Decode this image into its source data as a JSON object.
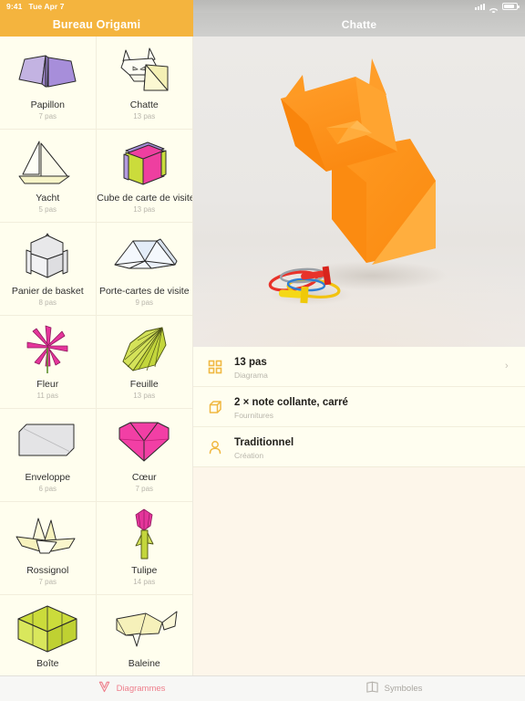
{
  "status_bar": {
    "time": "9:41",
    "date": "Tue Apr 7",
    "icons": [
      "signal-icon",
      "wifi-icon",
      "battery-icon"
    ]
  },
  "sidebar": {
    "header_title": "Bureau Origami",
    "background_color": "#FFFEEE",
    "accent_color": "#F4B43E",
    "steps_unit": "pas",
    "items": [
      {
        "name": "Papillon",
        "steps": "7 pas",
        "icon": "origami-butterfly-icon",
        "color": "#B9A5DC"
      },
      {
        "name": "Chatte",
        "steps": "13 pas",
        "icon": "origami-cat-icon",
        "color": "#F4F0B4"
      },
      {
        "name": "Yacht",
        "steps": "5 pas",
        "icon": "origami-yacht-icon",
        "color": "#F7F4C8"
      },
      {
        "name": "Cube de carte de visite",
        "steps": "13 pas",
        "icon": "origami-card-cube-icon",
        "color": "#EE3FA0"
      },
      {
        "name": "Panier de basket",
        "steps": "8 pas",
        "icon": "origami-basket-icon",
        "color": "#E8E8EA"
      },
      {
        "name": "Porte-cartes de visite",
        "steps": "9 pas",
        "icon": "origami-card-holder-icon",
        "color": "#EFF4FB"
      },
      {
        "name": "Fleur",
        "steps": "11 pas",
        "icon": "origami-flower-icon",
        "color": "#E5359B"
      },
      {
        "name": "Feuille",
        "steps": "13 pas",
        "icon": "origami-leaf-icon",
        "color": "#C3D63C"
      },
      {
        "name": "Enveloppe",
        "steps": "6 pas",
        "icon": "origami-envelope-icon",
        "color": "#E4E4E6"
      },
      {
        "name": "Cœur",
        "steps": "7 pas",
        "icon": "origami-heart-icon",
        "color": "#F23FA5"
      },
      {
        "name": "Rossignol",
        "steps": "7 pas",
        "icon": "origami-nightingale-icon",
        "color": "#F7F2BD"
      },
      {
        "name": "Tulipe",
        "steps": "14 pas",
        "icon": "origami-tulip-icon",
        "color": "#E5359B"
      },
      {
        "name": "Boîte",
        "steps": "",
        "icon": "origami-box-icon",
        "color": "#CBDC3B"
      },
      {
        "name": "Baleine",
        "steps": "",
        "icon": "origami-whale-icon",
        "color": "#F6F1BA"
      }
    ]
  },
  "detail": {
    "header_title": "Chatte",
    "photo_alt": "origami-cat-photo",
    "rows": [
      {
        "icon": "grid-icon",
        "title": "13 pas",
        "subtitle": "Diagrama",
        "chevron": "›"
      },
      {
        "icon": "cube-icon",
        "title": "2 × note collante, carré",
        "subtitle": "Fournitures",
        "chevron": ""
      },
      {
        "icon": "person-icon",
        "title": "Traditionnel",
        "subtitle": "Création",
        "chevron": ""
      }
    ]
  },
  "tab_bar": {
    "tabs": [
      {
        "label": "Diagrammes",
        "icon": "folded-paper-icon",
        "active": true,
        "color": "#EE7F8C"
      },
      {
        "label": "Symboles",
        "icon": "open-book-icon",
        "active": false,
        "color": "#a9a6a0"
      }
    ]
  }
}
